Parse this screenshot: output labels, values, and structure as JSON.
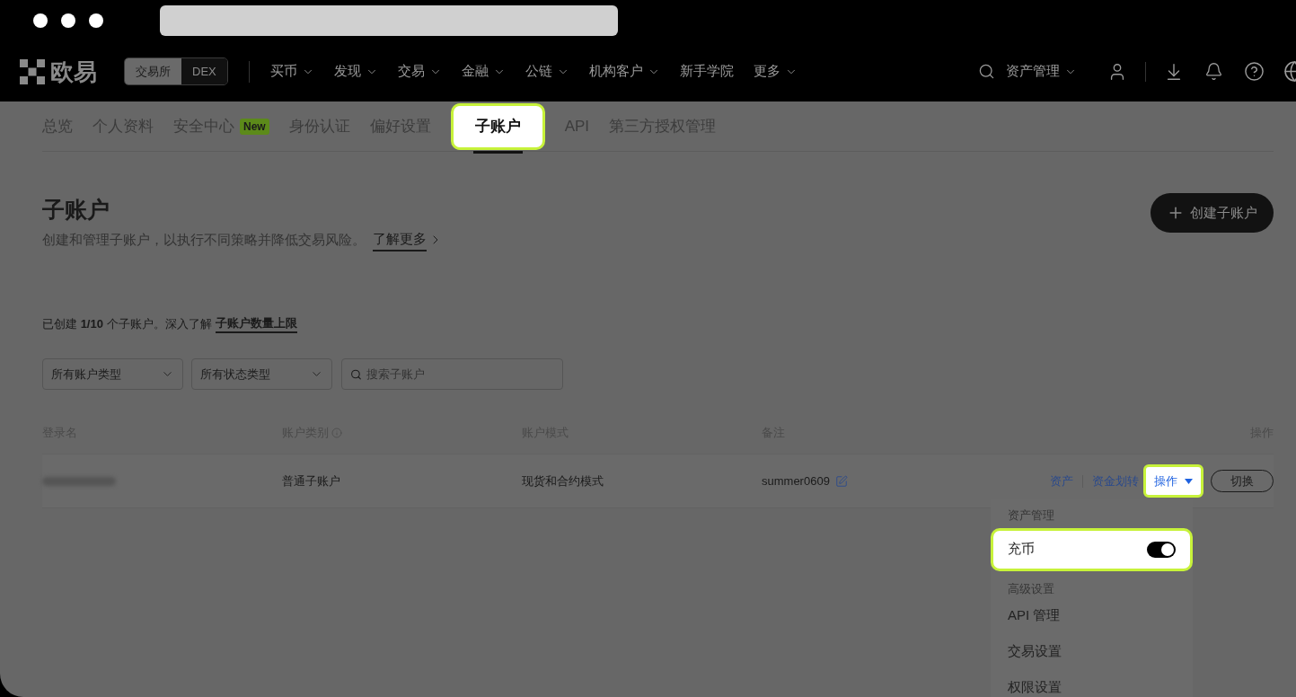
{
  "nav": {
    "logo": "欧易",
    "mode_switch": [
      {
        "label": "交易所",
        "selected": true
      },
      {
        "label": "DEX",
        "selected": false
      }
    ],
    "menu": [
      {
        "label": "买币",
        "caret": true
      },
      {
        "label": "发现",
        "caret": true
      },
      {
        "label": "交易",
        "caret": true
      },
      {
        "label": "金融",
        "caret": true
      },
      {
        "label": "公链",
        "caret": true
      },
      {
        "label": "机构客户",
        "caret": true
      },
      {
        "label": "新手学院",
        "caret": false
      },
      {
        "label": "更多",
        "caret": true
      }
    ],
    "asset_menu": "资产管理"
  },
  "tabs": [
    {
      "label": "总览",
      "selected": false,
      "highlighted": false
    },
    {
      "label": "个人资料",
      "selected": false,
      "highlighted": false
    },
    {
      "label": "安全中心",
      "selected": false,
      "highlighted": false,
      "badge": "New"
    },
    {
      "label": "身份认证",
      "selected": false,
      "highlighted": false
    },
    {
      "label": "偏好设置",
      "selected": false,
      "highlighted": false
    },
    {
      "label": "子账户",
      "selected": true,
      "highlighted": true
    },
    {
      "label": "API",
      "selected": false,
      "highlighted": false
    },
    {
      "label": "第三方授权管理",
      "selected": false,
      "highlighted": false
    }
  ],
  "header": {
    "title": "子账户",
    "description": "创建和管理子账户，以执行不同策略并降低交易风险。",
    "learn_more": "了解更多",
    "create_button": "创建子账户"
  },
  "summary": {
    "text": "已创建 **1/10** 个子账户。深入了解",
    "link": "子账户数量上限"
  },
  "filters": [
    {
      "kind": "select",
      "label": "所有账户类型"
    },
    {
      "kind": "select",
      "label": "所有状态类型"
    },
    {
      "kind": "search",
      "placeholder": "搜索子账户"
    }
  ],
  "table": {
    "columns": [
      {
        "label": "登录名",
        "info": false
      },
      {
        "label": "账户类别",
        "info": true
      },
      {
        "label": "账户模式",
        "info": false
      },
      {
        "label": "备注",
        "info": false
      },
      {
        "label": "操作",
        "info": false
      }
    ],
    "rows": [
      {
        "account_type": "普通子账户",
        "mode": "现货和合约模式",
        "note": "summer0609",
        "links": [
          "资产",
          "资金划转"
        ],
        "menu_button": {
          "label": "操作",
          "highlighted": true
        },
        "switch_button": "切换"
      }
    ]
  },
  "dropdown": {
    "sections": [
      {
        "heading": "资产管理",
        "items": [
          {
            "kind": "toggle",
            "label": "充币",
            "on": true,
            "highlighted": true
          }
        ]
      },
      {
        "heading": "高级设置",
        "items": [
          {
            "kind": "link",
            "label": "API 管理"
          },
          {
            "kind": "link",
            "label": "交易设置"
          },
          {
            "kind": "link",
            "label": "权限设置"
          }
        ]
      }
    ]
  }
}
